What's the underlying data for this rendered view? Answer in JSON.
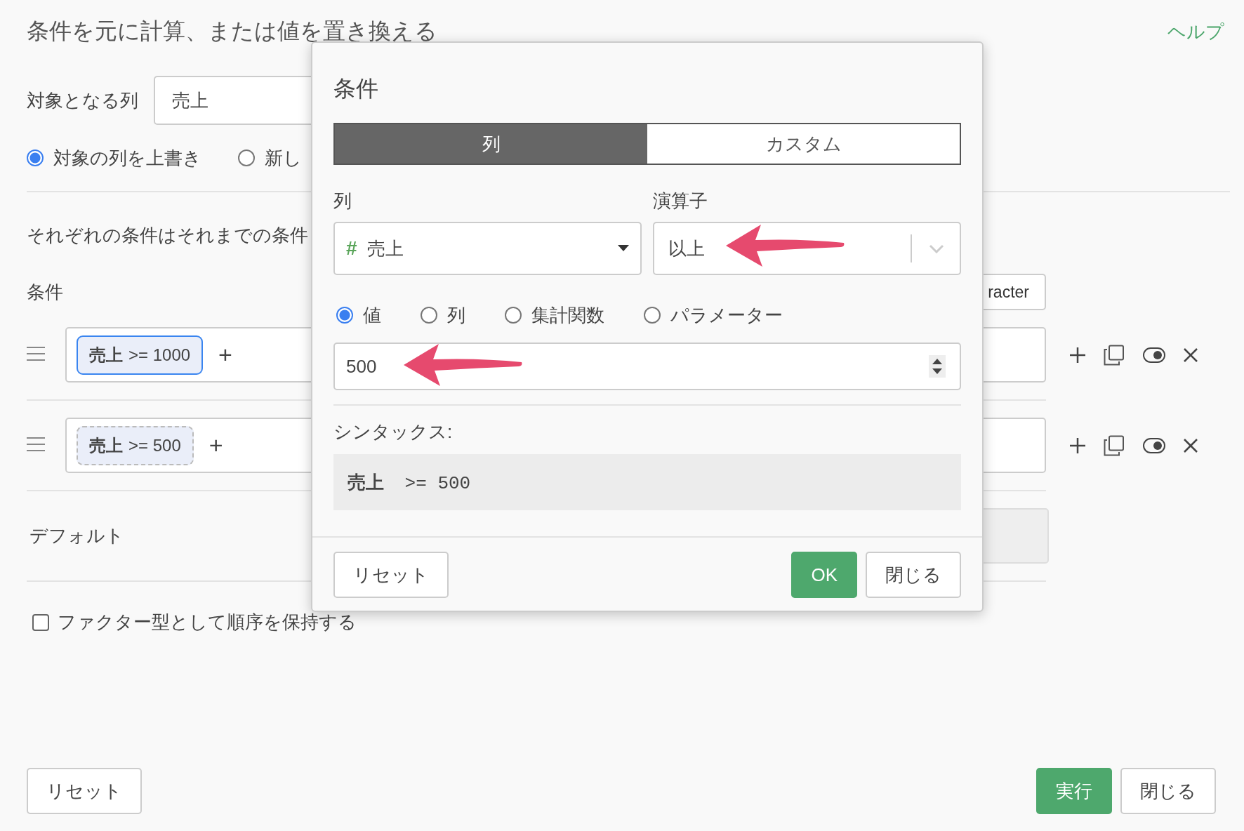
{
  "page": {
    "title": "条件を元に計算、または値を置き換える",
    "help_link": "ヘルプ",
    "target_column": {
      "label": "対象となる列",
      "value": "売上"
    },
    "output_options": [
      {
        "label": "対象の列を上書き",
        "selected": true
      },
      {
        "label": "新し",
        "selected": false
      }
    ],
    "description": "それぞれの条件はそれまでの条件",
    "conditions_label": "条件",
    "type_button": "racter",
    "conditions": [
      {
        "chip": "**売上** >= 1000",
        "selected": true,
        "add": "+"
      },
      {
        "chip": "**売上** >= 500",
        "selected": false,
        "add": "+"
      }
    ],
    "default_label": "デフォルト",
    "keep_factor": {
      "label": "ファクター型として順序を保持する",
      "checked": false
    },
    "buttons": {
      "reset": "リセット",
      "run": "実行",
      "close": "閉じる"
    }
  },
  "dialog": {
    "title": "条件",
    "tabs": [
      {
        "label": "列",
        "selected": true
      },
      {
        "label": "カスタム",
        "selected": false
      }
    ],
    "column_label": "列",
    "column_type": "#",
    "column_value": "売上",
    "operator_label": "演算子",
    "operator_value": "以上",
    "value_types": [
      {
        "label": "値",
        "selected": true
      },
      {
        "label": "列",
        "selected": false
      },
      {
        "label": "集計関数",
        "selected": false
      },
      {
        "label": "パラメーター",
        "selected": false
      }
    ],
    "value": "500",
    "syntax_label": "シンタックス:",
    "syntax": "**売上** >= 500",
    "buttons": {
      "reset": "リセット",
      "ok": "OK",
      "close": "閉じる"
    }
  }
}
